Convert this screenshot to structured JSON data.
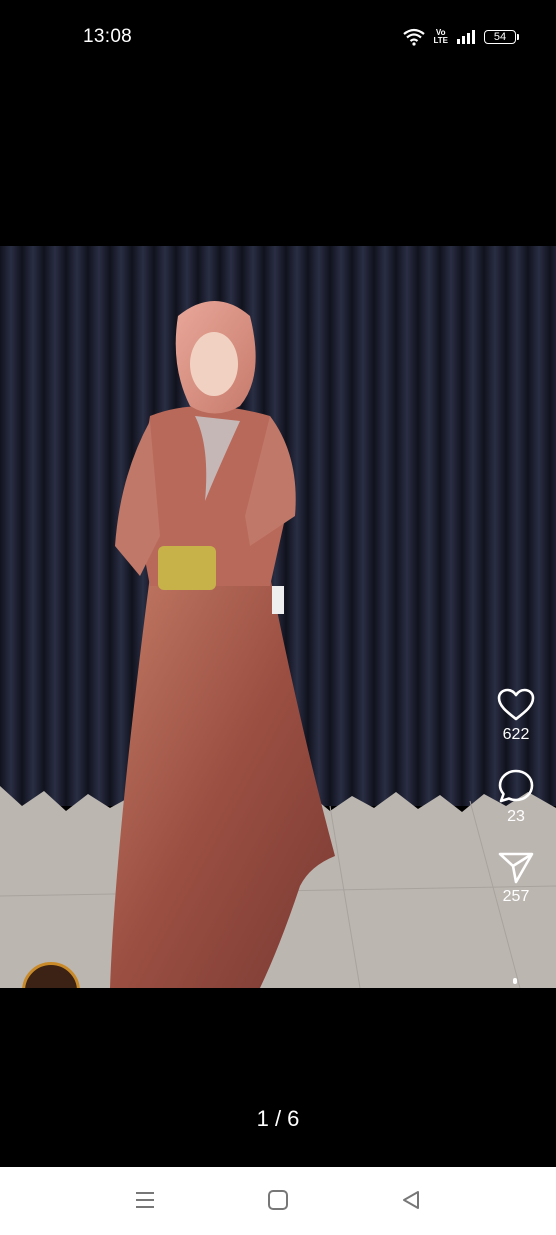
{
  "status_bar": {
    "time": "13:08",
    "volte_top": "Vo",
    "volte_bottom": "LTE",
    "battery": "54",
    "icons": [
      "wifi-icon",
      "volte-icon",
      "signal-icon",
      "battery-icon"
    ]
  },
  "post": {
    "image_subject": "woman in rose satin hijab evening gown",
    "actions": [
      {
        "icon": "heart-icon",
        "count": "622"
      },
      {
        "icon": "comment-icon",
        "count": "23"
      },
      {
        "icon": "share-icon",
        "count": "257"
      }
    ],
    "username_partial": "...",
    "page_indicator": "1 / 6"
  },
  "nav_bar": {
    "icons": [
      "menu-icon",
      "home-icon",
      "back-icon"
    ]
  },
  "colors": {
    "curtain": "#1a1d2b",
    "dress": "#a6594a",
    "floor": "#bdb7b2",
    "nav_background": "#ffffff"
  }
}
